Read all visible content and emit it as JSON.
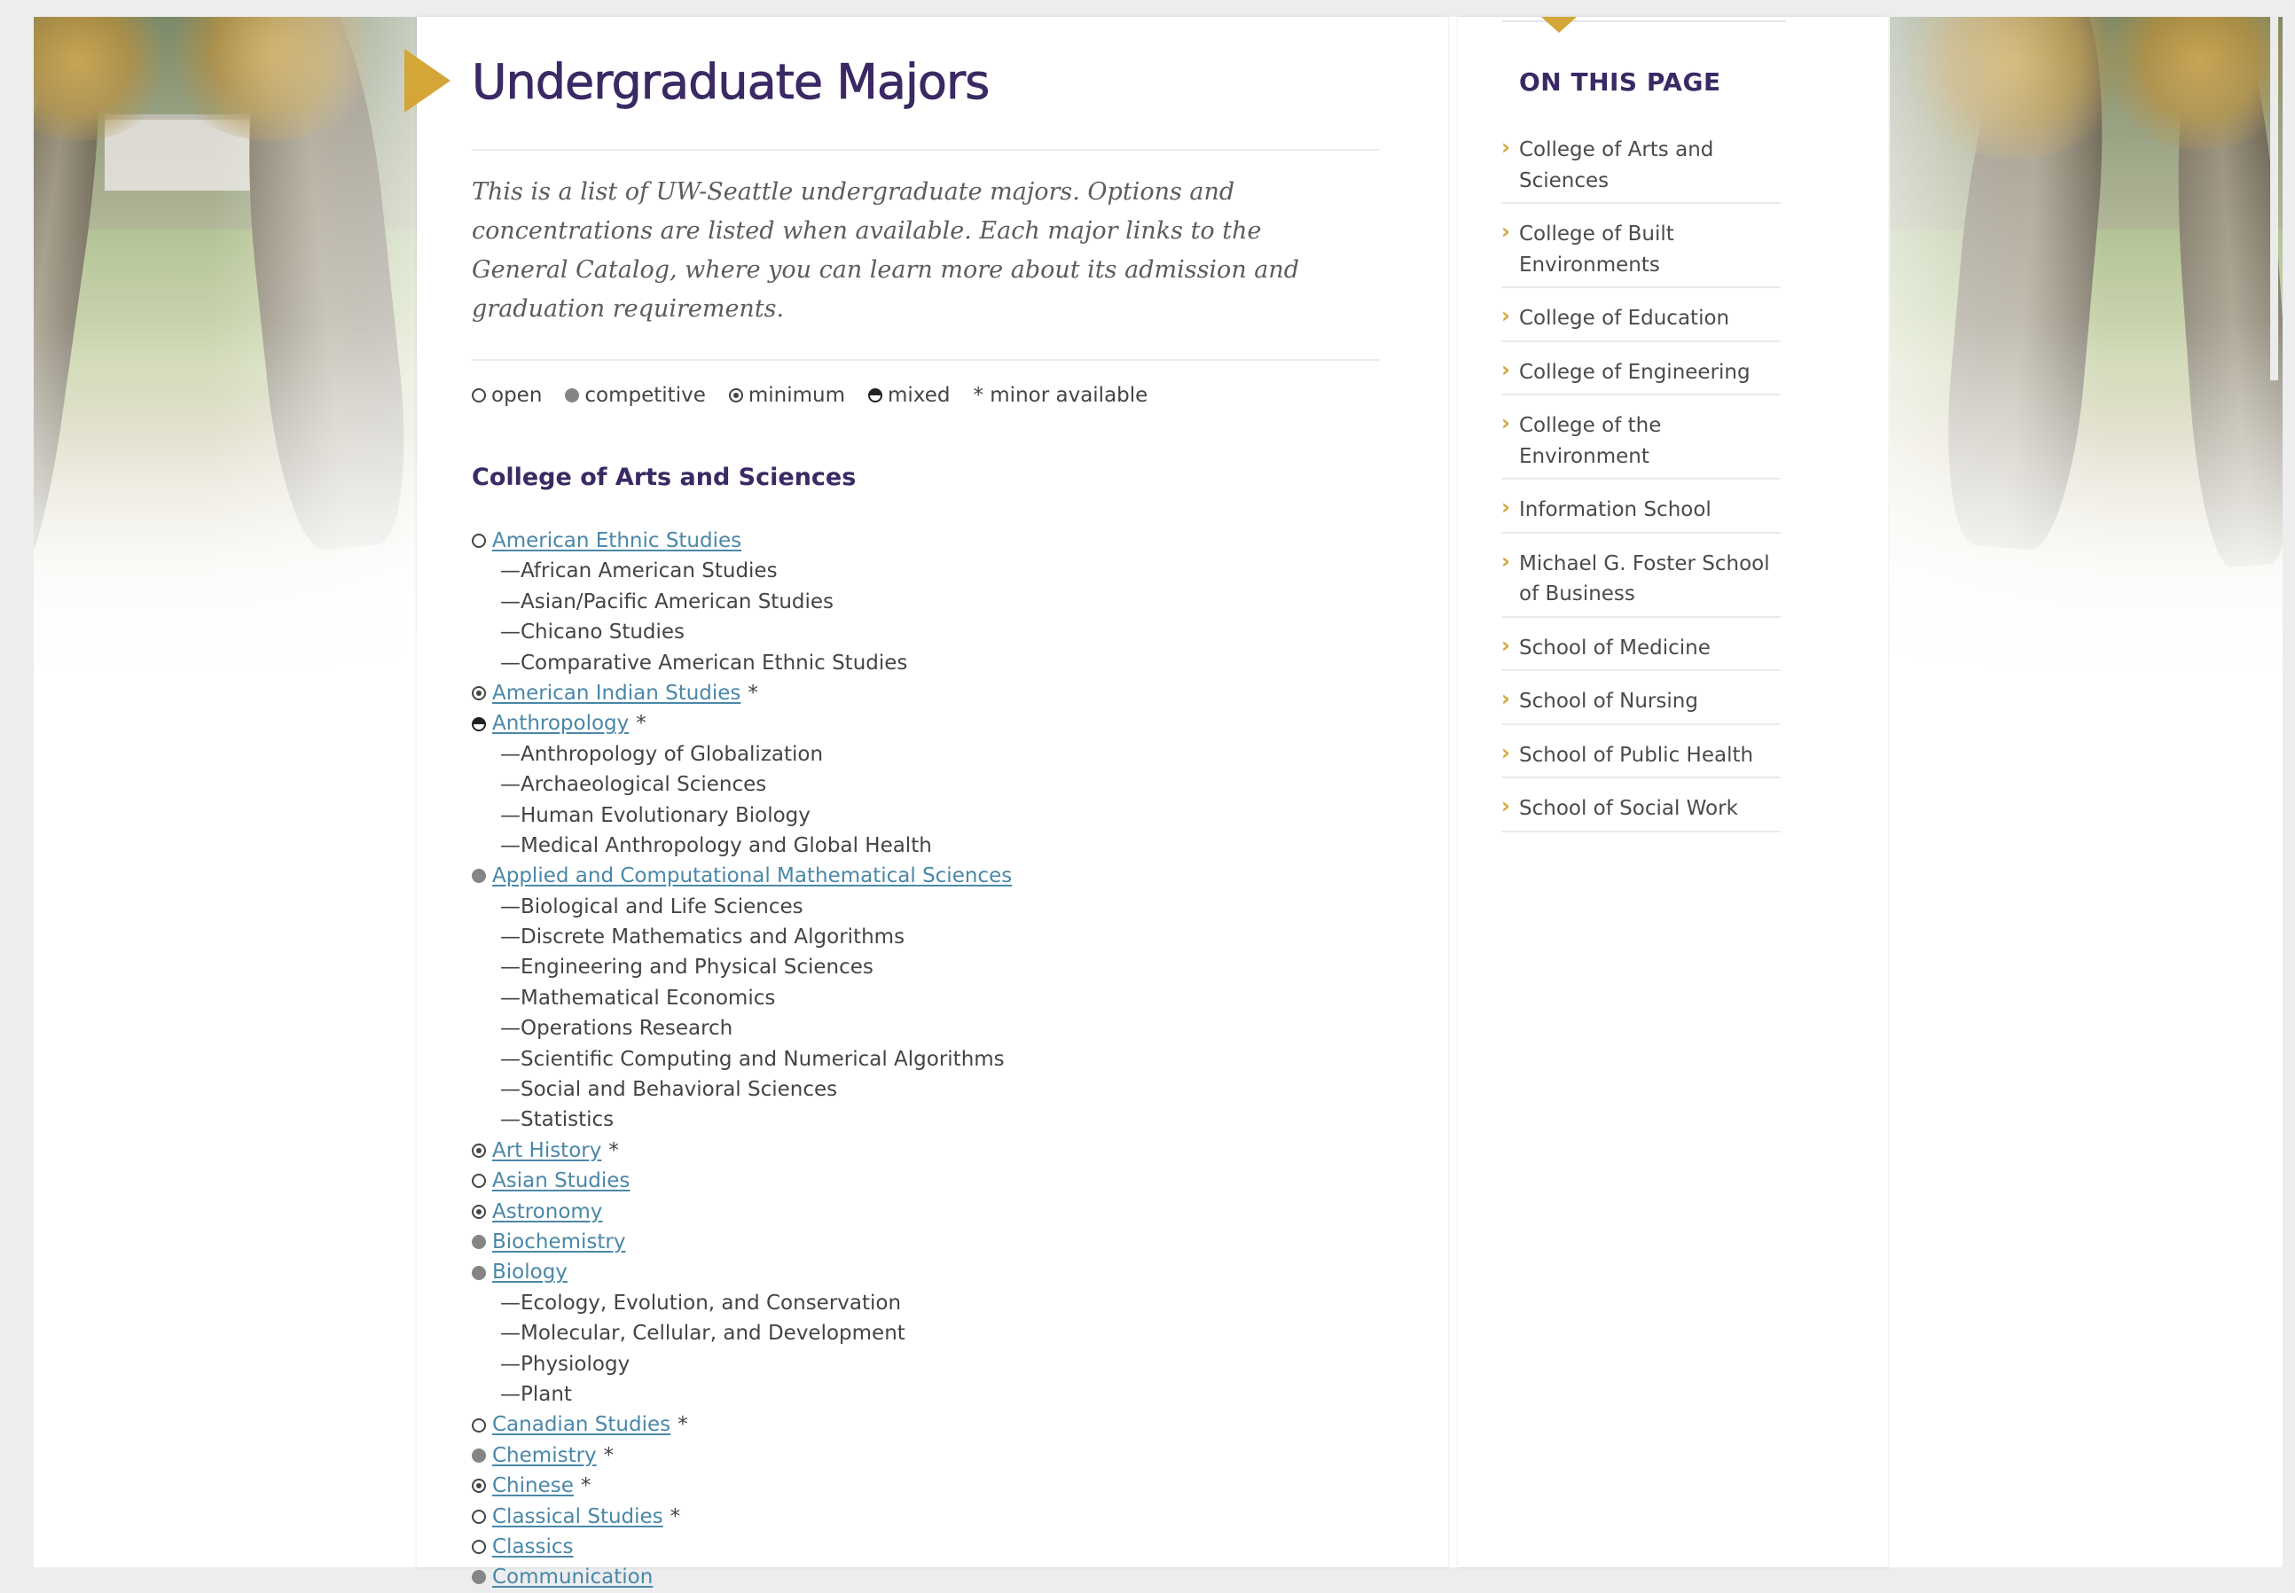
{
  "page": {
    "title": "Undergraduate Majors",
    "intro": "This is a list of UW-Seattle undergraduate majors. Options and concentrations are listed when available. Each major links to the General Catalog, where you can learn more about its admission and graduation requirements."
  },
  "legend": [
    {
      "type": "open",
      "label": "open"
    },
    {
      "type": "competitive",
      "label": "competitive"
    },
    {
      "type": "minimum",
      "label": "minimum"
    },
    {
      "type": "mixed",
      "label": "mixed"
    },
    {
      "type": "minor",
      "label": "* minor available"
    }
  ],
  "section": {
    "title": "College of Arts and Sciences"
  },
  "majors": [
    {
      "kind": "major",
      "type": "open",
      "label": "American Ethnic Studies",
      "minor": ""
    },
    {
      "kind": "sub",
      "label": "—African American Studies"
    },
    {
      "kind": "sub",
      "label": "—Asian/Pacific American Studies"
    },
    {
      "kind": "sub",
      "label": "—Chicano Studies"
    },
    {
      "kind": "sub",
      "label": "—Comparative American Ethnic Studies"
    },
    {
      "kind": "major",
      "type": "minimum",
      "label": "American Indian Studies",
      "minor": "*"
    },
    {
      "kind": "major",
      "type": "mixed",
      "label": "Anthropology",
      "minor": "*"
    },
    {
      "kind": "sub",
      "label": "—Anthropology of Globalization"
    },
    {
      "kind": "sub",
      "label": "—Archaeological Sciences"
    },
    {
      "kind": "sub",
      "label": "—Human Evolutionary Biology"
    },
    {
      "kind": "sub",
      "label": "—Medical Anthropology and Global Health"
    },
    {
      "kind": "major",
      "type": "competitive",
      "label": "Applied and Computational Mathematical Sciences",
      "minor": ""
    },
    {
      "kind": "sub",
      "label": "—Biological and Life Sciences"
    },
    {
      "kind": "sub",
      "label": "—Discrete Mathematics and Algorithms"
    },
    {
      "kind": "sub",
      "label": "—Engineering and Physical Sciences"
    },
    {
      "kind": "sub",
      "label": "—Mathematical Economics"
    },
    {
      "kind": "sub",
      "label": "—Operations Research"
    },
    {
      "kind": "sub",
      "label": "—Scientific Computing and Numerical Algorithms"
    },
    {
      "kind": "sub",
      "label": "—Social and Behavioral Sciences"
    },
    {
      "kind": "sub",
      "label": "—Statistics"
    },
    {
      "kind": "major",
      "type": "minimum",
      "label": "Art History",
      "minor": "*"
    },
    {
      "kind": "major",
      "type": "open",
      "label": "Asian Studies",
      "minor": ""
    },
    {
      "kind": "major",
      "type": "minimum",
      "label": "Astronomy",
      "minor": ""
    },
    {
      "kind": "major",
      "type": "competitive",
      "label": "Biochemistry",
      "minor": ""
    },
    {
      "kind": "major",
      "type": "competitive",
      "label": "Biology",
      "minor": ""
    },
    {
      "kind": "sub",
      "label": "—Ecology, Evolution, and Conservation"
    },
    {
      "kind": "sub",
      "label": "—Molecular, Cellular, and Development"
    },
    {
      "kind": "sub",
      "label": "—Physiology"
    },
    {
      "kind": "sub",
      "label": "—Plant"
    },
    {
      "kind": "major",
      "type": "open",
      "label": "Canadian Studies",
      "minor": "*"
    },
    {
      "kind": "major",
      "type": "competitive",
      "label": "Chemistry",
      "minor": "*"
    },
    {
      "kind": "major",
      "type": "minimum",
      "label": "Chinese",
      "minor": "*"
    },
    {
      "kind": "major",
      "type": "open",
      "label": "Classical Studies",
      "minor": "*"
    },
    {
      "kind": "major",
      "type": "open",
      "label": "Classics",
      "minor": ""
    },
    {
      "kind": "major",
      "type": "competitive",
      "label": "Communication",
      "minor": ""
    }
  ],
  "sidebar": {
    "heading": "ON THIS PAGE",
    "items": [
      "College of Arts and Sciences",
      "College of Built Environments",
      "College of Education",
      "College of Engineering",
      "College of the Environment",
      "Information School",
      "Michael G. Foster School of Business",
      "School of Medicine",
      "School of Nursing",
      "School of Public Health",
      "School of Social Work"
    ]
  },
  "colors": {
    "heading": "#3a2964",
    "accent": "#d4a537",
    "link": "#4a87a8",
    "body_text": "#444444",
    "intro_text": "#5c5c5c"
  }
}
